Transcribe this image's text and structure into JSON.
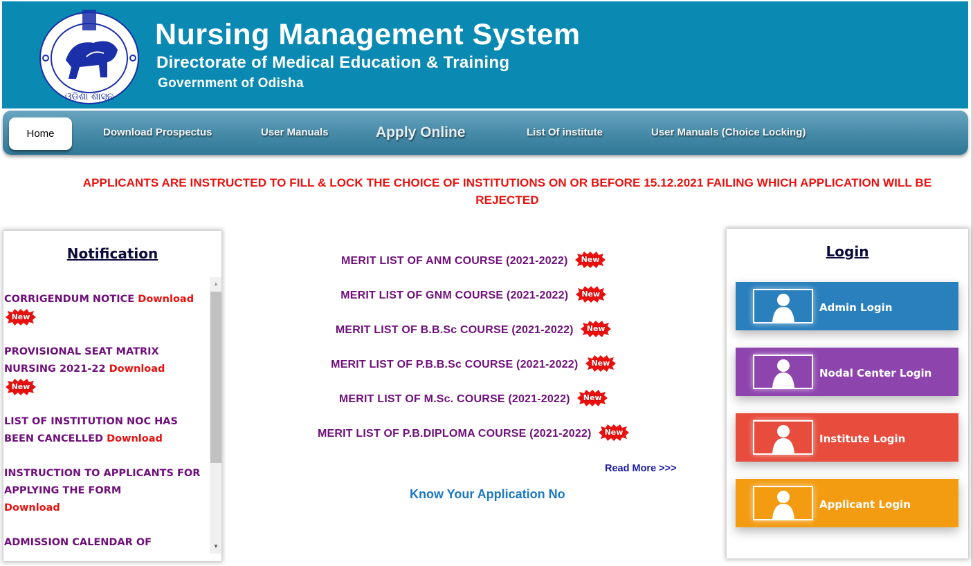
{
  "header": {
    "title": "Nursing Management System",
    "subtitle": "Directorate of Medical Education & Training",
    "government": "Government of Odisha",
    "emblem_icon": "odisha-government-emblem",
    "background_color": "#0a8ab2"
  },
  "nav": {
    "items": [
      {
        "label": "Home",
        "active": true
      },
      {
        "label": "Download Prospectus"
      },
      {
        "label": "User Manuals"
      },
      {
        "label": "Apply Online"
      },
      {
        "label": "List Of institute"
      },
      {
        "label": "User Manuals (Choice Locking)"
      }
    ]
  },
  "notice": {
    "text": "APPLICANTS ARE INSTRUCTED TO FILL & LOCK THE CHOICE OF INSTITUTIONS ON OR BEFORE 15.12.2021 FAILING WHICH APPLICATION WILL BE REJECTED",
    "color": "#e8110f"
  },
  "notifications": {
    "title": "Notification",
    "items": [
      {
        "text": "CORRIGENDUM NOTICE",
        "link": "Download",
        "badge": "New"
      },
      {
        "text": "PROVISIONAL SEAT MATRIX NURSING 2021-22",
        "link": "Download",
        "badge": "New"
      },
      {
        "text": "LIST OF INSTITUTION NOC HAS BEEN CANCELLED",
        "link": "Download"
      },
      {
        "text": "INSTRUCTION TO APPLICANTS FOR APPLYING THE FORM",
        "link": "Download"
      },
      {
        "text": "ADMISSION CALENDAR OF"
      }
    ]
  },
  "merit_lists": {
    "items": [
      {
        "label": "MERIT LIST OF ANM COURSE (2021-2022)",
        "badge": "New"
      },
      {
        "label": "MERIT LIST OF GNM COURSE (2021-2022)",
        "badge": "New"
      },
      {
        "label": "MERIT LIST OF B.B.Sc COURSE (2021-2022)",
        "badge": "New"
      },
      {
        "label": "MERIT LIST OF P.B.B.Sc COURSE (2021-2022)",
        "badge": "New"
      },
      {
        "label": "MERIT LIST OF M.Sc. COURSE (2021-2022)",
        "badge": "New"
      },
      {
        "label": "MERIT LIST OF P.B.DIPLOMA COURSE (2021-2022)",
        "badge": "New"
      }
    ],
    "read_more": "Read More >>>",
    "know_application": "Know Your Application No"
  },
  "login": {
    "title": "Login",
    "buttons": [
      {
        "label": "Admin Login",
        "color": "#2a80bd"
      },
      {
        "label": "Nodal Center Login",
        "color": "#8e44ad"
      },
      {
        "label": "Institute Login",
        "color": "#e74c3c"
      },
      {
        "label": "Applicant Login",
        "color": "#f39c12"
      }
    ]
  }
}
